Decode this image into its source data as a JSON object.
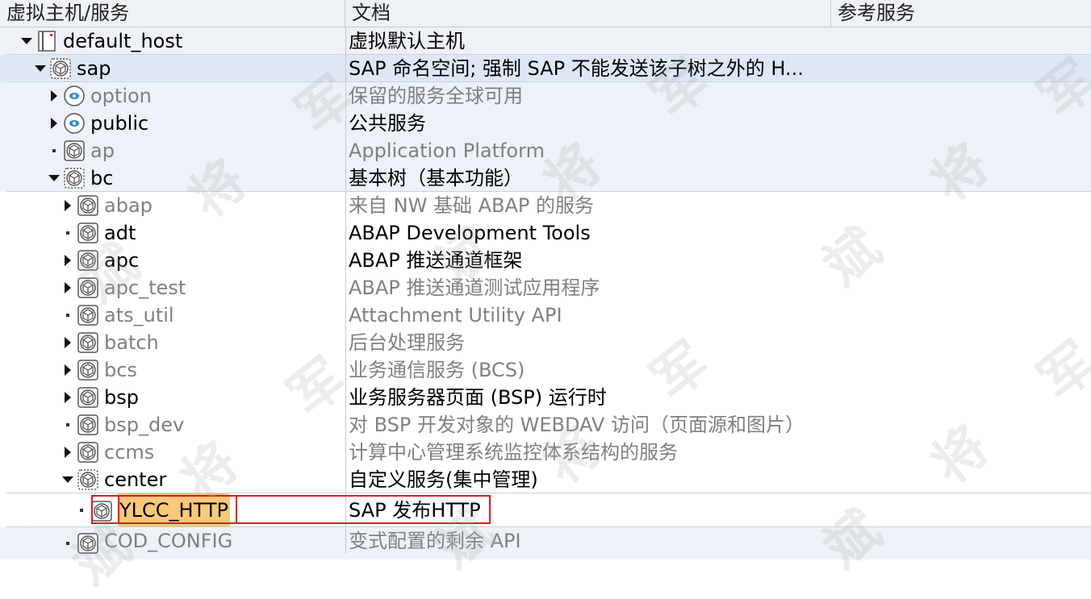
{
  "header": {
    "col_node": "虚拟主机/服务",
    "col_doc": "文档",
    "col_ref": "参考服务"
  },
  "rows": [
    {
      "label": "default_host",
      "doc": "虚拟默认主机",
      "indent": 0,
      "toggle": "expanded",
      "icon": "host-icon",
      "active": true,
      "bg": "b1"
    },
    {
      "label": "sap",
      "doc": "SAP 命名空间; 强制 SAP 不能发送该子树之外的 H...",
      "indent": 1,
      "toggle": "expanded",
      "icon": "service-node-icon",
      "active": true,
      "bg": "b2"
    },
    {
      "label": "option",
      "doc": "保留的服务全球可用",
      "indent": 2,
      "toggle": "collapsed",
      "icon": "global-service-icon",
      "active": false,
      "bg": "b3"
    },
    {
      "label": "public",
      "doc": "公共服务",
      "indent": 2,
      "toggle": "collapsed",
      "icon": "global-service-icon",
      "active": true,
      "bg": "b3"
    },
    {
      "label": "ap",
      "doc": "Application Platform",
      "indent": 2,
      "toggle": "leaf",
      "icon": "service-icon",
      "active": false,
      "bg": "b3"
    },
    {
      "label": "bc",
      "doc": "基本树（基本功能）",
      "indent": 2,
      "toggle": "expanded",
      "icon": "service-node-icon",
      "active": true,
      "bg": "b3"
    },
    {
      "label": "abap",
      "doc": "来自 NW 基础 ABAP 的服务",
      "indent": 3,
      "toggle": "collapsed",
      "icon": "service-icon",
      "active": false,
      "bg": "white"
    },
    {
      "label": "adt",
      "doc": "ABAP Development Tools",
      "indent": 3,
      "toggle": "leaf",
      "icon": "service-icon",
      "active": true,
      "bg": "white"
    },
    {
      "label": "apc",
      "doc": "ABAP 推送通道框架",
      "indent": 3,
      "toggle": "collapsed",
      "icon": "service-icon",
      "active": true,
      "bg": "white"
    },
    {
      "label": "apc_test",
      "doc": "ABAP 推送通道测试应用程序",
      "indent": 3,
      "toggle": "collapsed",
      "icon": "service-icon",
      "active": false,
      "bg": "white"
    },
    {
      "label": "ats_util",
      "doc": "Attachment Utility API",
      "indent": 3,
      "toggle": "leaf",
      "icon": "service-icon",
      "active": false,
      "bg": "white"
    },
    {
      "label": "batch",
      "doc": "后台处理服务",
      "indent": 3,
      "toggle": "collapsed",
      "icon": "service-icon",
      "active": false,
      "bg": "white"
    },
    {
      "label": "bcs",
      "doc": "业务通信服务 (BCS)",
      "indent": 3,
      "toggle": "collapsed",
      "icon": "service-icon",
      "active": false,
      "bg": "white"
    },
    {
      "label": "bsp",
      "doc": "业务服务器页面 (BSP) 运行时",
      "indent": 3,
      "toggle": "collapsed",
      "icon": "service-icon",
      "active": true,
      "bg": "white"
    },
    {
      "label": "bsp_dev",
      "doc": "对 BSP 开发对象的 WEBDAV 访问（页面源和图片）",
      "indent": 3,
      "toggle": "leaf",
      "icon": "service-icon",
      "active": false,
      "bg": "white"
    },
    {
      "label": "ccms",
      "doc": "计算中心管理系统监控体系结构的服务",
      "indent": 3,
      "toggle": "collapsed",
      "icon": "service-icon",
      "active": false,
      "bg": "white"
    },
    {
      "label": "center",
      "doc": "自定义服务(集中管理)",
      "indent": 3,
      "toggle": "expanded",
      "icon": "service-node-icon",
      "active": true,
      "bg": "white"
    },
    {
      "label": "YLCC_HTTP",
      "doc": "SAP 发布HTTP",
      "indent": 4,
      "toggle": "leaf",
      "icon": "service-icon",
      "active": true,
      "bg": "sel",
      "highlight": true
    },
    {
      "label": "COD_CONFIG",
      "doc": "变式配置的剩余 API",
      "indent": 3,
      "toggle": "leaf",
      "icon": "service-icon",
      "active": false,
      "bg": "last"
    }
  ],
  "watermark": "斌 将 军",
  "colors": {
    "header_bg": "#eef1f5",
    "selected_highlight": "#f9c979",
    "annotation_red": "#e8161d",
    "inactive_text": "#808080"
  }
}
